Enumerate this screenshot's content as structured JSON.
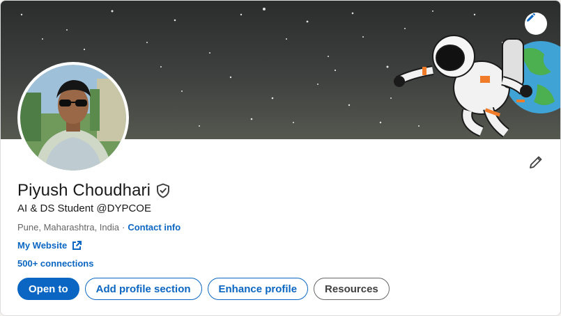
{
  "profile": {
    "name": "Piyush Choudhari",
    "headline": "AI & DS Student @DYPCOE",
    "location": "Pune, Maharashtra, India",
    "separator": "·",
    "contact_info_label": "Contact info",
    "website_label": "My Website",
    "connections_label": "500+ connections"
  },
  "actions": {
    "open_to": "Open to",
    "add_profile_section": "Add profile section",
    "enhance_profile": "Enhance profile",
    "resources": "Resources"
  },
  "icons": {
    "banner_edit": "pencil-icon",
    "intro_edit": "pencil-icon",
    "verified": "verified-shield-icon",
    "external_link": "external-link-icon"
  },
  "colors": {
    "accent": "#0a66c2",
    "text_primary": "#191919",
    "text_secondary": "#666666",
    "banner_dark": "#2b2d2c"
  }
}
